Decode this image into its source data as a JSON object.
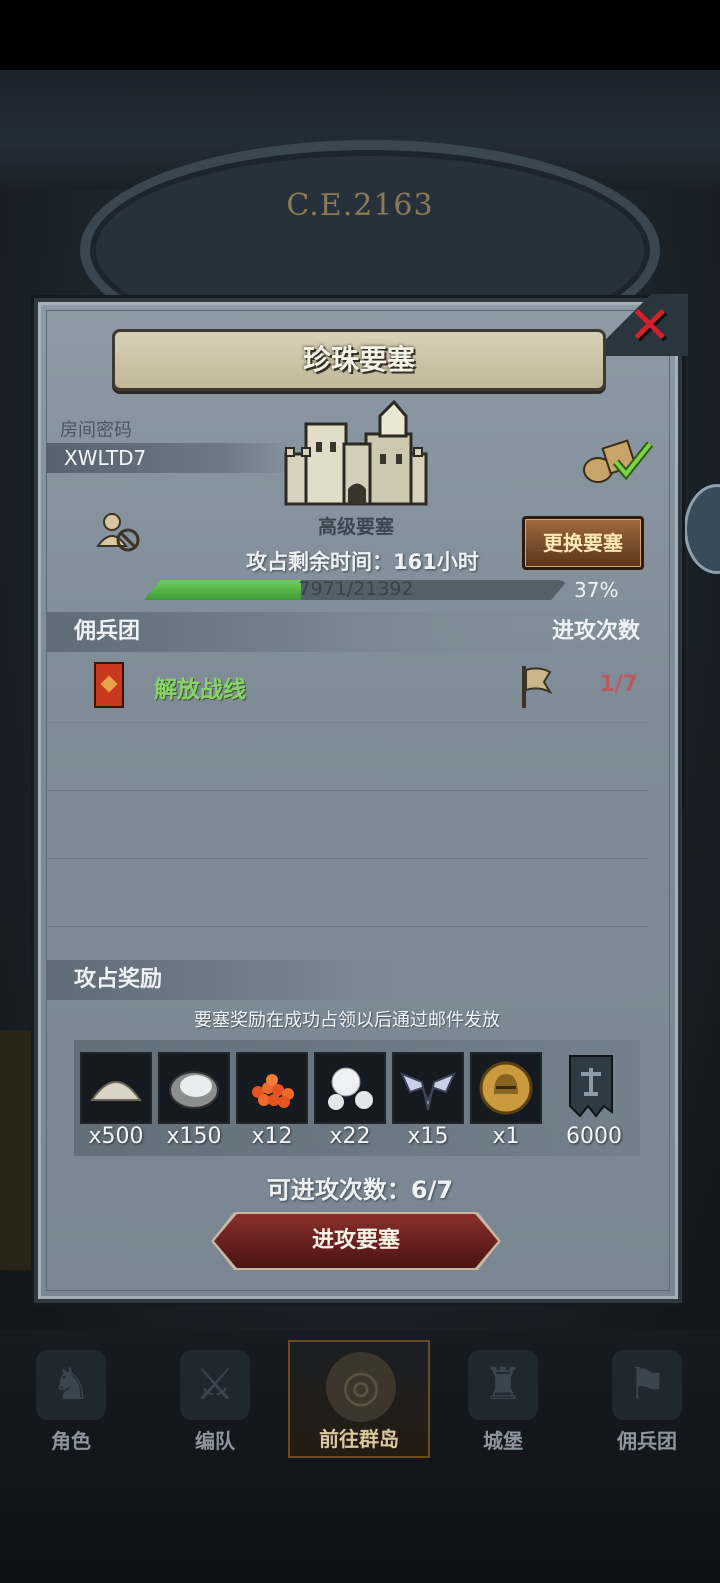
{
  "background": {
    "year_label": "C.E.2163"
  },
  "dialog": {
    "title": "珍珠要塞",
    "room_code_label": "房间密码",
    "room_code": "XWLTD7",
    "fortress_type": "高级要塞",
    "change_button": "更换要塞",
    "time_label": "攻占剩余时间：161小时",
    "progress": {
      "text": "7971/21392",
      "percent_text": "37%",
      "fraction": 0.37
    },
    "mercenary_header": "佣兵团",
    "attacks_header": "进攻次数",
    "guilds": [
      {
        "name": "解放战线",
        "attacks": "1/7"
      }
    ],
    "reward_header": "攻占奖励",
    "reward_note": "要塞奖励在成功占领以后通过邮件发放",
    "rewards": [
      {
        "icon": "sand-pile-icon",
        "qty": "x500"
      },
      {
        "icon": "oyster-icon",
        "qty": "x150"
      },
      {
        "icon": "fish-roe-icon",
        "qty": "x12"
      },
      {
        "icon": "pearls-icon",
        "qty": "x22"
      },
      {
        "icon": "winged-emblem-icon",
        "qty": "x15"
      },
      {
        "icon": "knight-helmet-coin-icon",
        "qty": "x1"
      },
      {
        "icon": "guild-banner-icon",
        "qty": "6000"
      }
    ],
    "available_attacks": "可进攻次数：6/7",
    "attack_button": "进攻要塞"
  },
  "bottom_nav": [
    {
      "label": "角色",
      "icon": "character-icon"
    },
    {
      "label": "编队",
      "icon": "formation-icon"
    },
    {
      "label": "前往群岛",
      "icon": "islands-icon",
      "active": true
    },
    {
      "label": "城堡",
      "icon": "castle-icon"
    },
    {
      "label": "佣兵团",
      "icon": "mercenary-icon"
    }
  ],
  "colors": {
    "progress_fill": "#4caf3f",
    "guild_name": "#89d468",
    "attack_count": "#b85c63",
    "close_x": "#d4202a"
  }
}
